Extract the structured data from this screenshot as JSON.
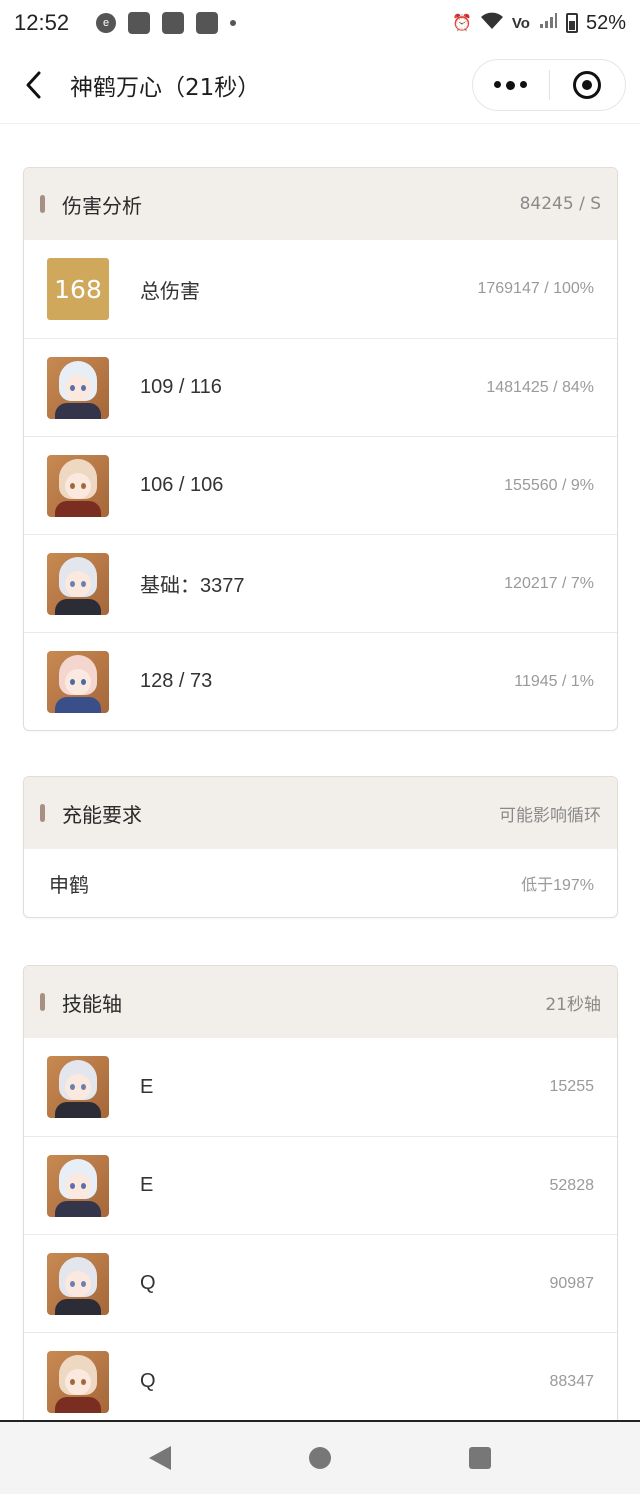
{
  "status_bar": {
    "time": "12:52",
    "battery": "52%",
    "icons": [
      "app-notification-icon",
      "alarm-icon",
      "wifi-icon",
      "volte-icon",
      "signal-icon",
      "battery-icon"
    ]
  },
  "nav": {
    "title": "神鹤万心（21秒）"
  },
  "damage_card": {
    "title": "伤害分析",
    "dps": "84245 / S",
    "total_rank": "168",
    "rows": [
      {
        "label": "总伤害",
        "value": "1769147 / 100%"
      },
      {
        "label": "109 / 116",
        "value": "1481425 / 84%",
        "avatar": "ayaka-avatar"
      },
      {
        "label": "106 / 106",
        "value": "155560 / 9%",
        "avatar": "kazuha-avatar"
      },
      {
        "label": "基础：3377",
        "value": "120217 / 7%",
        "avatar": "shenhe-avatar"
      },
      {
        "label": "128 / 73",
        "value": "11945 / 1%",
        "avatar": "kokomi-avatar"
      }
    ]
  },
  "energy_card": {
    "title": "充能要求",
    "note": "可能影响循环",
    "rows": [
      {
        "label": "申鹤",
        "value": "低于197%"
      }
    ]
  },
  "skill_card": {
    "title": "技能轴",
    "note": "21秒轴",
    "rows": [
      {
        "label": "E",
        "value": "15255",
        "avatar": "shenhe-avatar"
      },
      {
        "label": "E",
        "value": "52828",
        "avatar": "ayaka-avatar"
      },
      {
        "label": "Q",
        "value": "90987",
        "avatar": "shenhe-avatar"
      },
      {
        "label": "Q",
        "value": "88347",
        "avatar": "kazuha-avatar"
      }
    ]
  },
  "colors": {
    "accent_gold": "#d0a85b",
    "head_bg": "#f2efea",
    "head_mark": "#a78f84"
  }
}
